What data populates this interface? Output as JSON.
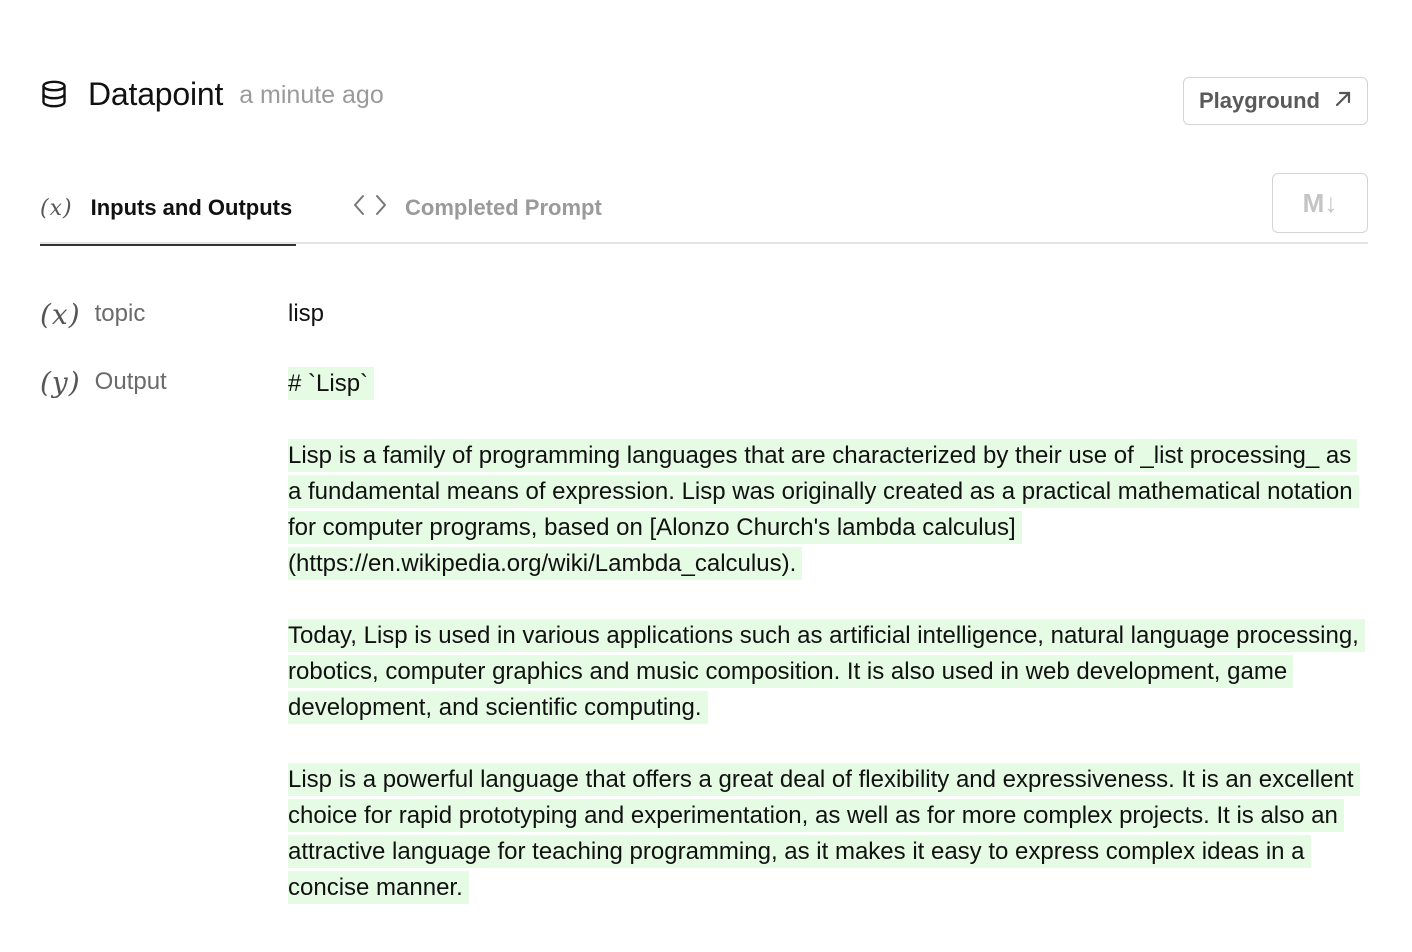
{
  "header": {
    "title": "Datapoint",
    "timestamp": "a minute ago",
    "playground_label": "Playground"
  },
  "tabs": [
    {
      "icon": "(x)",
      "label": "Inputs and Outputs",
      "active": true
    },
    {
      "icon": "<>",
      "label": "Completed Prompt",
      "active": false
    }
  ],
  "markdown_toggle_label": "M↓",
  "inputs": [
    {
      "icon": "(x)",
      "name": "topic",
      "value": "lisp"
    }
  ],
  "output": {
    "icon": "(y)",
    "name": "Output",
    "paragraphs": [
      "# `Lisp`",
      "Lisp is a family of programming languages that are characterized by their use of _list processing_ as a fundamental means of expression. Lisp was originally created as a practical mathematical notation for computer programs, based on [Alonzo Church's lambda calculus](https://en.wikipedia.org/wiki/Lambda_calculus).",
      "Today, Lisp is used in various applications such as artificial intelligence, natural language processing, robotics, computer graphics and music composition. It is also used in web development, game development, and scientific computing.",
      "Lisp is a powerful language that offers a great deal of flexibility and expressiveness. It is an excellent choice for rapid prototyping and experimentation, as well as for more complex projects. It is also an attractive language for teaching programming, as it makes it easy to express complex ideas in a concise manner."
    ],
    "highlight_color": "#e5fbe4"
  },
  "icons": {
    "header": "database-icon",
    "playground": "arrow-up-right-icon",
    "tab_inputs": "variable-x-icon",
    "tab_prompt": "code-brackets-icon"
  }
}
